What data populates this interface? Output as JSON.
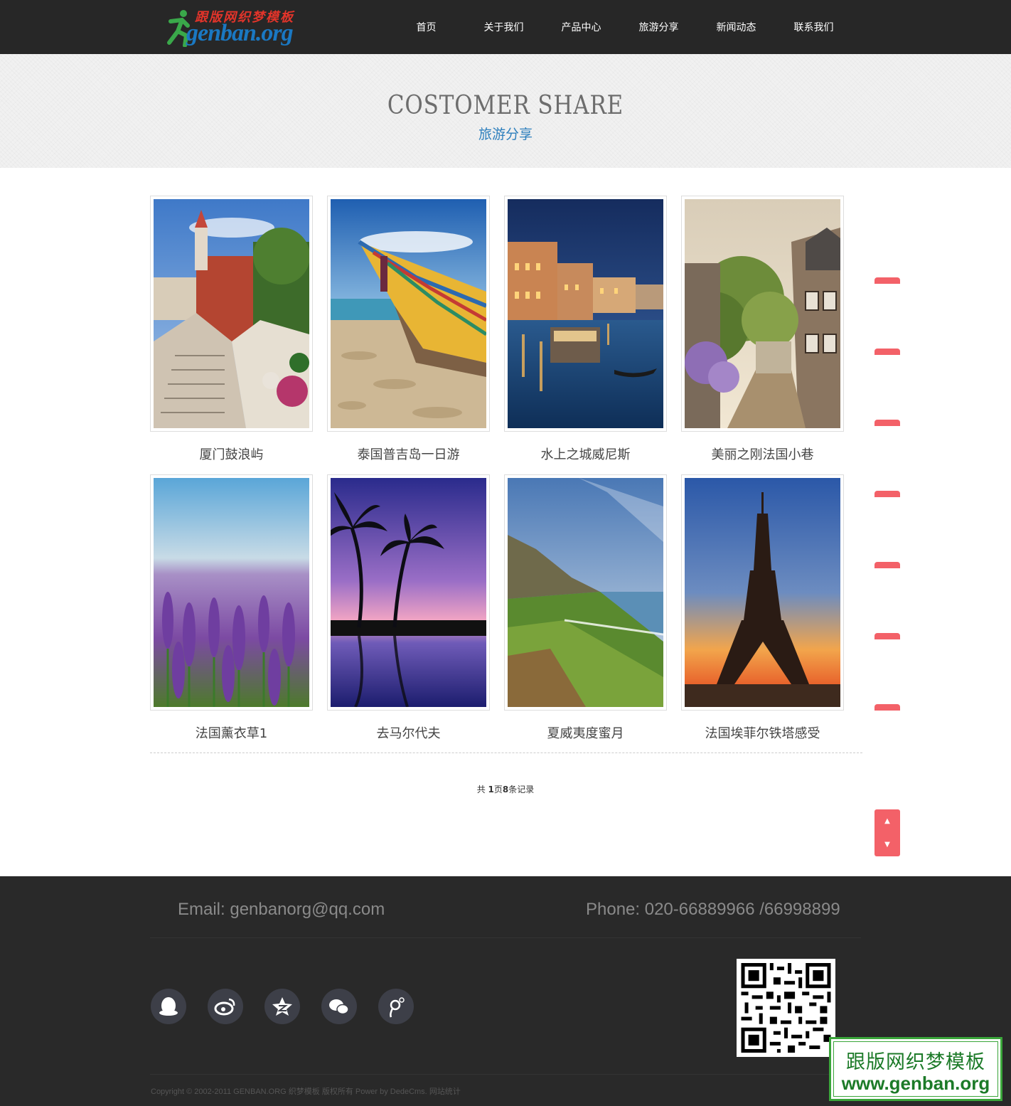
{
  "header": {
    "logo_cn": "跟版网织梦模板",
    "logo_en": "genban.org",
    "nav": [
      "首页",
      "关于我们",
      "产品中心",
      "旅游分享",
      "新闻动态",
      "联系我们"
    ]
  },
  "banner": {
    "title": "COSTOMER SHARE",
    "subtitle": "旅游分享"
  },
  "gallery": {
    "items": [
      {
        "title": "厦门鼓浪屿",
        "scene": "villa-stairs"
      },
      {
        "title": "泰国普吉岛一日游",
        "scene": "boat-beach"
      },
      {
        "title": "水上之城威尼斯",
        "scene": "venice-night"
      },
      {
        "title": "美丽之刚法国小巷",
        "scene": "french-alley"
      },
      {
        "title": "法国薰衣草1",
        "scene": "lavender"
      },
      {
        "title": "去马尔代夫",
        "scene": "palm-sunset"
      },
      {
        "title": "夏威夷度蜜月",
        "scene": "coast-cliff"
      },
      {
        "title": "法国埃菲尔铁塔感受",
        "scene": "eiffel"
      }
    ]
  },
  "pager": {
    "prefix": "共 ",
    "pages": "1",
    "middle": "页",
    "records": "8",
    "suffix": "条记录"
  },
  "scroll": {
    "up": "▲",
    "down": "▼"
  },
  "footer": {
    "email": "Email: genbanorg@qq.com",
    "phone": "Phone: 020-66889966 /66998899",
    "social": [
      "qq-icon",
      "weibo-icon",
      "qzone-icon",
      "wechat-icon",
      "tencent-weibo-icon"
    ],
    "copyright": "Copyright © 2002-2011 GENBAN.ORG 织梦模板 版权所有 Power by DedeCms.",
    "stats_link": "网站统计"
  },
  "watermark": {
    "cn": "跟版网织梦模板",
    "en": "www.genban.org"
  },
  "colors": {
    "header_bg": "#272727",
    "accent_red": "#f36168",
    "subtitle_blue": "#2d7fbd",
    "footer_bg": "#292929"
  }
}
